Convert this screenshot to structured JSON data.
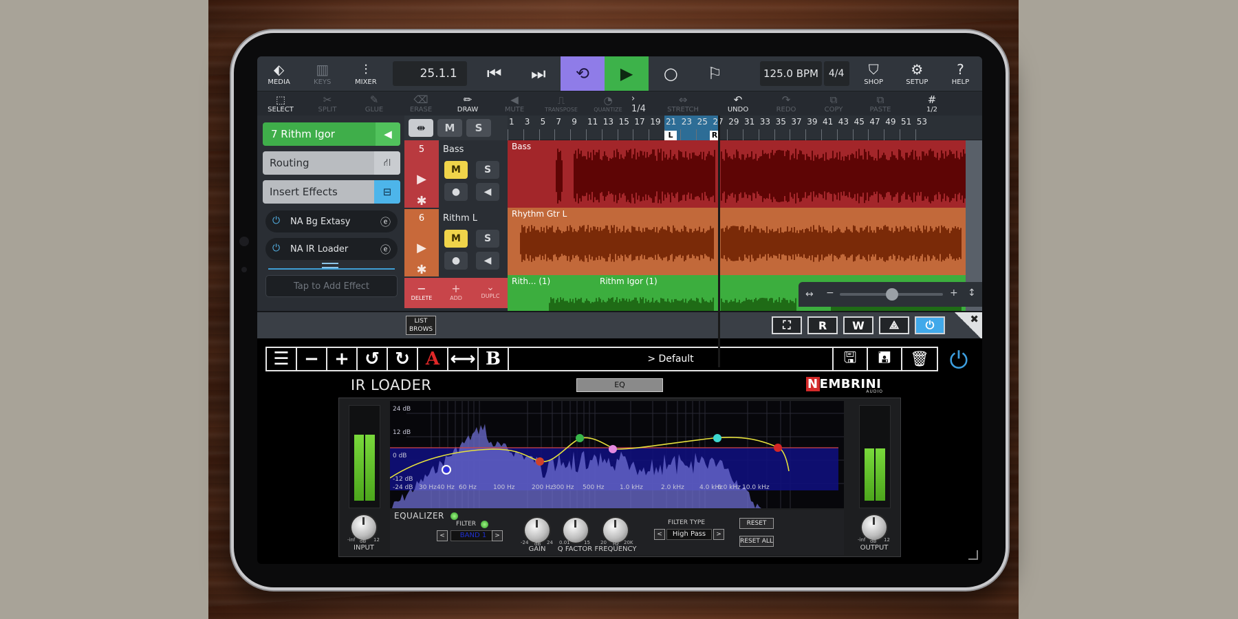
{
  "topbar": {
    "media": "MEDIA",
    "keys": "KEYS",
    "mixer": "MIXER",
    "position": "25.1.1",
    "bpm": "125.0 BPM",
    "signature": "4/4",
    "shop": "SHOP",
    "setup": "SETUP",
    "help": "HELP"
  },
  "toolbar": {
    "select": "SELECT",
    "split": "SPLIT",
    "glue": "GLUE",
    "erase": "ERASE",
    "draw": "DRAW",
    "mute": "MUTE",
    "transpose": "TRANSPOSE",
    "quantize": "QUANTIZE",
    "quantize_value": "1/4",
    "stretch": "STRETCH",
    "undo": "UNDO",
    "redo": "REDO",
    "copy": "COPY",
    "paste": "PASTE",
    "grid": "1/2"
  },
  "left_panel": {
    "track_name": "7  Rithm Igor",
    "routing": "Routing",
    "insert_effects": "Insert Effects",
    "effects": [
      "NA Bg Extasy",
      "NA IR Loader"
    ],
    "add_effect": "Tap to Add Effect"
  },
  "track_header": {
    "tracks": [
      {
        "number": "5",
        "name": "Bass",
        "color": "#b93a3f"
      },
      {
        "number": "6",
        "name": "Rithm L",
        "color": "#c8693a"
      }
    ],
    "mute": "M",
    "solo": "S",
    "delete": "DELETE",
    "add": "ADD",
    "duplicate": "DUPLC"
  },
  "ruler": {
    "ticks": [
      "1",
      "3",
      "5",
      "7",
      "9",
      "11",
      "13",
      "15",
      "17",
      "19",
      "21",
      "23",
      "25",
      "27",
      "29",
      "31",
      "33",
      "35",
      "37",
      "39",
      "41",
      "43",
      "45",
      "47",
      "49",
      "51",
      "53"
    ],
    "loop_left": "L",
    "loop_right": "R"
  },
  "lanes": [
    {
      "label": "Bass",
      "color": "#a3262a",
      "wave": "#5e0505"
    },
    {
      "label": "Rhythm Gtr L",
      "color": "#c2693a",
      "wave": "#7a2a08"
    },
    {
      "label": "Rith... (1)",
      "label2": "Rithm Igor (1)",
      "color": "#3cae3e",
      "wave": "#1f6b16"
    }
  ],
  "plugin_bar": {
    "list_brows": "LIST BROWS",
    "r_button": "R",
    "w_button": "W"
  },
  "plugin": {
    "preset": "> Default",
    "title": "IR LOADER",
    "eq_tab": "EQ",
    "brand": "EMBRINI",
    "brand_n": "N",
    "brand_sub": "AUDIO",
    "input": "INPUT",
    "output": "OUTPUT",
    "meter_scale": [
      "-inf",
      "dB",
      "12"
    ],
    "db_labels": [
      "24 dB",
      "12 dB",
      "0 dB",
      "-12 dB",
      "-24 dB"
    ],
    "freq_labels": [
      "30 Hz",
      "40 Hz",
      "60 Hz",
      "100 Hz",
      "200 Hz",
      "300 Hz",
      "500 Hz",
      "1.0 kHz",
      "2.0 kHz",
      "4.0 kHz",
      "6.0 kHz",
      "10.0 kHz"
    ],
    "equalizer": "EQUALIZER",
    "filter": "FILTER",
    "band": "BAND 1",
    "gain": "GAIN",
    "gain_scale": [
      "-24",
      "dB",
      "24"
    ],
    "q_factor": "Q FACTOR",
    "q_scale": [
      "0.01",
      "15"
    ],
    "frequency": "FREQUENCY",
    "freq_scale": [
      "20",
      "Hz",
      "20K"
    ],
    "filter_type_label": "FILTER TYPE",
    "filter_type": "High Pass",
    "reset": "RESET",
    "reset_all": "RESET ALL"
  },
  "colors": {
    "loop": "#8f7ce8",
    "play": "#3db24a",
    "accent": "#4db5ea",
    "mute_on": "#f0d44a"
  }
}
